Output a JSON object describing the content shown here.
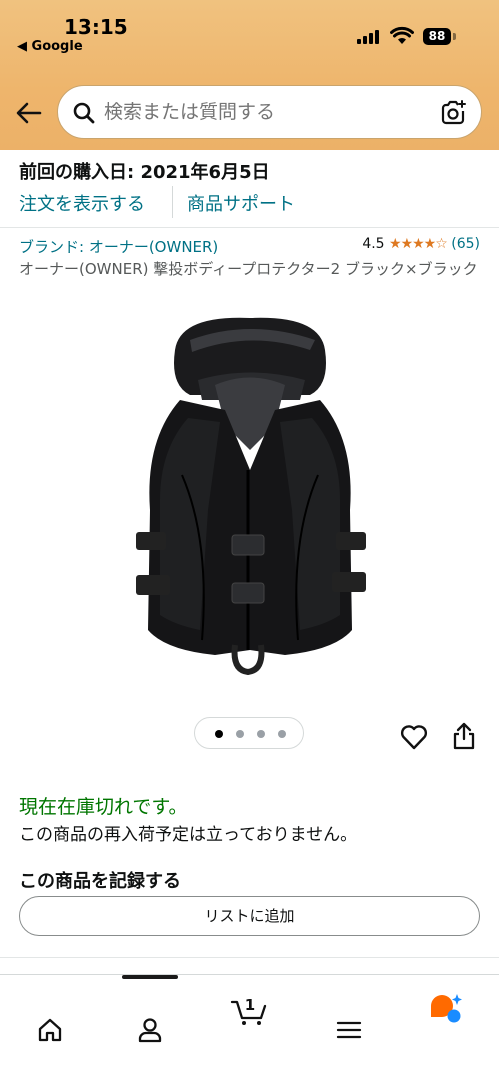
{
  "status_bar": {
    "time": "13:15",
    "back_app": "◀ Google",
    "battery": "88"
  },
  "search": {
    "placeholder": "検索または質問する"
  },
  "purchase": {
    "last_purchase": "前回の購入日: 2021年6月5日",
    "view_order": "注文を表示する",
    "product_support": "商品サポート"
  },
  "product": {
    "brand": "ブランド: オーナー(OWNER)",
    "rating": "4.5",
    "stars": "★★★★☆",
    "review_count": "(65)",
    "title": "オーナー(OWNER) 撃投ボディープロテクター2 ブラック×ブラック"
  },
  "carousel": {
    "image_count": 4,
    "active_index": 0
  },
  "availability": {
    "stock_status": "現在在庫切れです。",
    "restock_note": "この商品の再入荷予定は立っておりません。",
    "record_heading": "この商品を記録する",
    "add_to_list": "リストに追加"
  },
  "bottom_nav": {
    "items": [
      {
        "icon": "home-icon"
      },
      {
        "icon": "account-icon"
      },
      {
        "icon": "cart-icon",
        "badge": "1"
      },
      {
        "icon": "menu-icon"
      },
      {
        "icon": "rufus-ai-icon"
      }
    ]
  },
  "colors": {
    "header_bg": "#eeb56c",
    "link": "#007185",
    "in_stock_green": "#007600",
    "star_orange": "#de7921",
    "rufus_orange": "#ff6a00",
    "rufus_blue": "#1a8cff"
  }
}
